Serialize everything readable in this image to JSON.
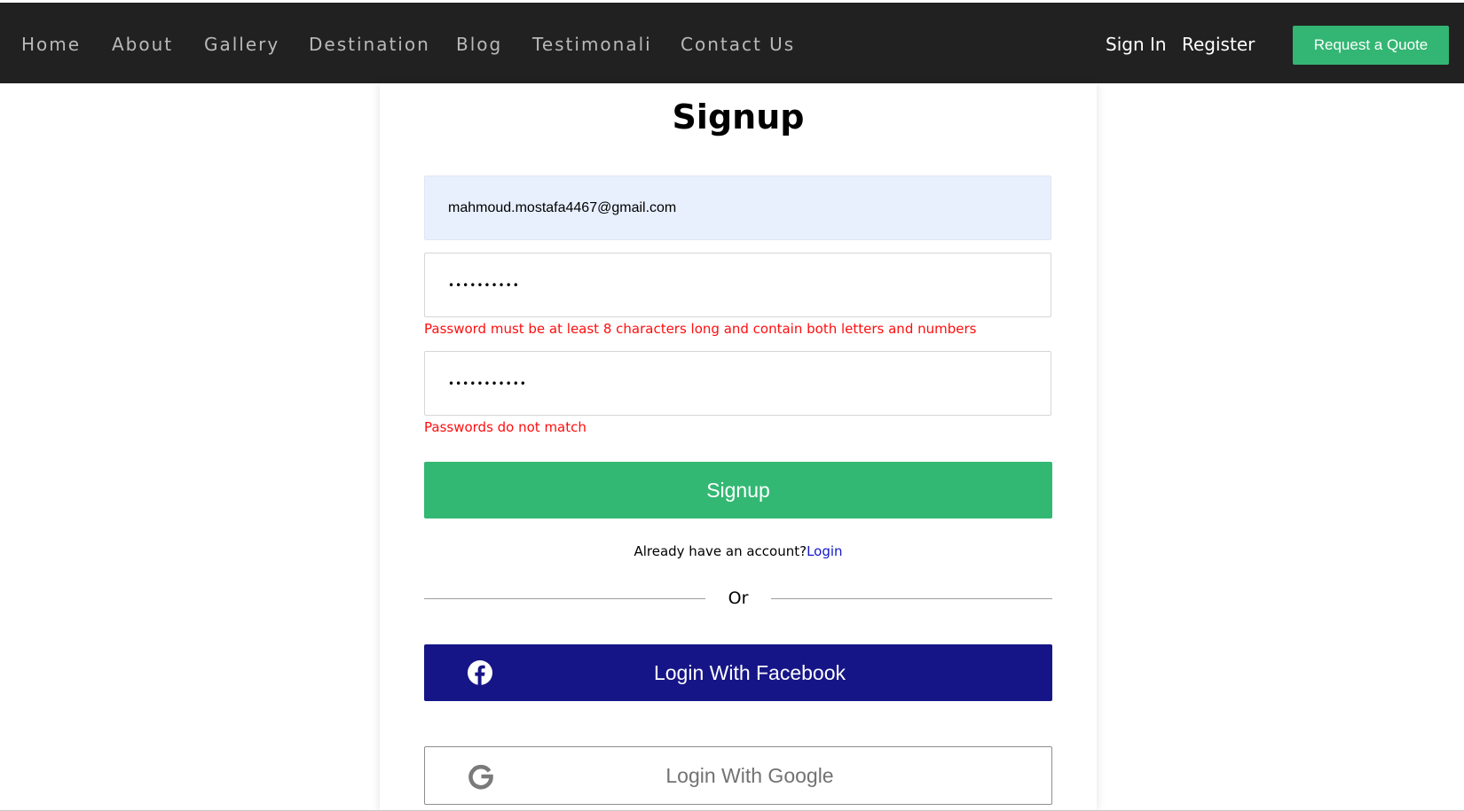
{
  "nav": {
    "links": [
      "Home",
      "About",
      "Gallery",
      "Destination",
      "Blog",
      "Testimonali",
      "Contact Us"
    ],
    "sign_in": "Sign In",
    "register": "Register",
    "quote_button": "Request a Quote"
  },
  "form": {
    "title": "Signup",
    "email_value": "mahmoud.mostafa4467@gmail.com",
    "password_value": "••••••••••",
    "password_error": "Password must be at least 8 characters long and contain both letters and numbers",
    "confirm_value": "•••••••••••",
    "confirm_error": "Passwords do not match",
    "submit_label": "Signup",
    "account_prompt": "Already have an account?",
    "login_link": "Login",
    "divider_text": "Or",
    "facebook_label": "Login With Facebook",
    "google_label": "Login With Google"
  },
  "icons": {
    "facebook": "facebook-icon",
    "google": "google-icon"
  },
  "colors": {
    "navbar_bg": "#212121",
    "accent_green": "#33b873",
    "facebook_blue": "#161587",
    "error_red": "#ff0d0d",
    "link_blue": "#1018c7",
    "autofill_bg": "#e8f0fe"
  }
}
